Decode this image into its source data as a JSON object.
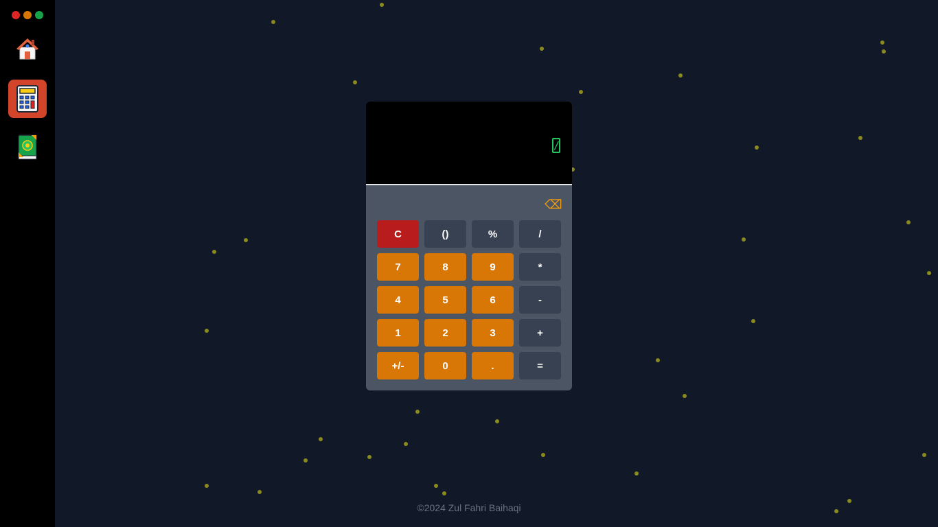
{
  "window_controls": [
    "close",
    "minimize",
    "maximize"
  ],
  "sidebar": {
    "apps": [
      {
        "name": "home",
        "icon": "house-icon"
      },
      {
        "name": "calculator",
        "icon": "calculator-icon",
        "active": true
      },
      {
        "name": "book",
        "icon": "book-icon"
      }
    ]
  },
  "calculator": {
    "display_value": "",
    "cursor_glyph": "/",
    "backspace_label": "⌫",
    "keys": {
      "clear": "C",
      "parens": "()",
      "percent": "%",
      "divide": "/",
      "seven": "7",
      "eight": "8",
      "nine": "9",
      "multiply": "*",
      "four": "4",
      "five": "5",
      "six": "6",
      "minus": "-",
      "one": "1",
      "two": "2",
      "three": "3",
      "plus": "+",
      "negate": "+/-",
      "zero": "0",
      "decimal": ".",
      "equals": "="
    }
  },
  "footer": {
    "text": "©2024 Zul Fahri Baihaqi"
  },
  "colors": {
    "background": "#111827",
    "sidebar": "#000000",
    "display_text": "#22c55e",
    "number_key": "#d97706",
    "operator_key": "#374151",
    "clear_key": "#b91c1c",
    "active_app": "#d2452a",
    "star": "#8a8a1e"
  }
}
